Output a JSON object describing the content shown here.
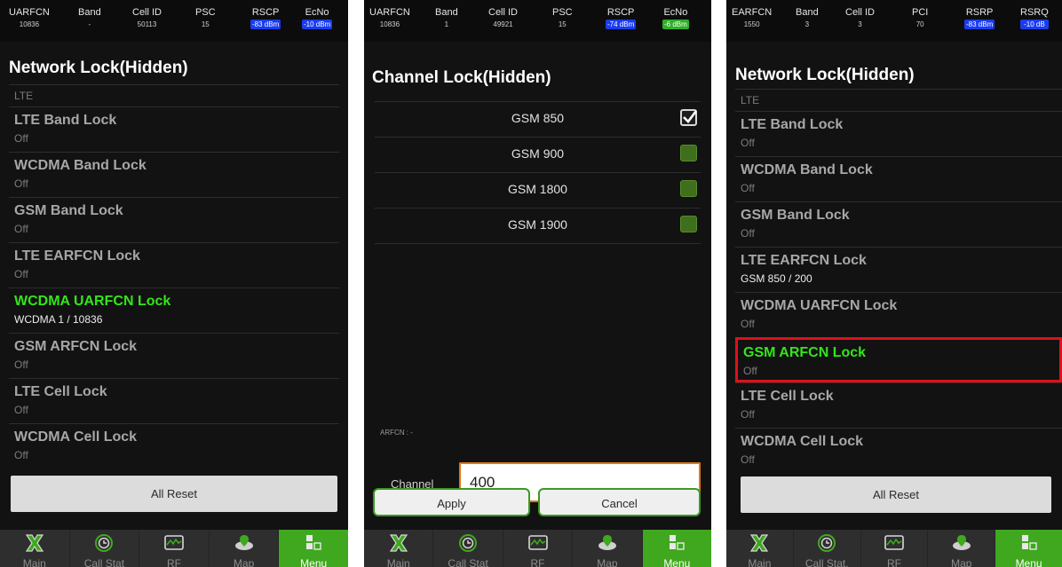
{
  "panel1": {
    "header": [
      {
        "label": "UARFCN",
        "value": "10836"
      },
      {
        "label": "Band",
        "value": "-"
      },
      {
        "label": "Cell ID",
        "value": "50113"
      },
      {
        "label": "PSC",
        "value": "15"
      },
      {
        "label": "RSCP",
        "value": "-83 dBm",
        "badge": "blue"
      },
      {
        "label": "EcNo",
        "value": "-10 dBm",
        "badge": "blue"
      }
    ],
    "title": "Network Lock(Hidden)",
    "section": "LTE",
    "items": [
      {
        "title": "LTE Band Lock",
        "sub": "Off"
      },
      {
        "title": "WCDMA Band Lock",
        "sub": "Off"
      },
      {
        "title": "GSM Band Lock",
        "sub": "Off"
      },
      {
        "title": "LTE EARFCN Lock",
        "sub": "Off"
      },
      {
        "title": "WCDMA UARFCN Lock",
        "sub": "WCDMA 1 / 10836",
        "active": true
      },
      {
        "title": "GSM ARFCN Lock",
        "sub": "Off"
      },
      {
        "title": "LTE Cell Lock",
        "sub": "Off"
      },
      {
        "title": "WCDMA Cell Lock",
        "sub": "Off"
      }
    ],
    "reset_label": "All Reset"
  },
  "panel2": {
    "header": [
      {
        "label": "UARFCN",
        "value": "10836"
      },
      {
        "label": "Band",
        "value": "1"
      },
      {
        "label": "Cell ID",
        "value": "49921"
      },
      {
        "label": "PSC",
        "value": "15"
      },
      {
        "label": "RSCP",
        "value": "-74 dBm",
        "badge": "blue"
      },
      {
        "label": "EcNo",
        "value": "-6 dBm",
        "badge": "green"
      }
    ],
    "title": "Channel Lock(Hidden)",
    "channels": [
      {
        "label": "GSM 850",
        "checked": true
      },
      {
        "label": "GSM 900",
        "checked": false
      },
      {
        "label": "GSM 1800",
        "checked": false
      },
      {
        "label": "GSM 1900",
        "checked": false
      }
    ],
    "arfcn_label": "ARFCN : -",
    "channel_label": "Channel",
    "channel_value": "400",
    "apply_label": "Apply",
    "cancel_label": "Cancel"
  },
  "panel3": {
    "header": [
      {
        "label": "EARFCN",
        "value": "1550"
      },
      {
        "label": "Band",
        "value": "3"
      },
      {
        "label": "Cell ID",
        "value": "3"
      },
      {
        "label": "PCI",
        "value": "70"
      },
      {
        "label": "RSRP",
        "value": "-83 dBm",
        "badge": "blue"
      },
      {
        "label": "RSRQ",
        "value": "-10 dB",
        "badge": "blue"
      }
    ],
    "title": "Network Lock(Hidden)",
    "section": "LTE",
    "items": [
      {
        "title": "LTE Band Lock",
        "sub": "Off"
      },
      {
        "title": "WCDMA Band Lock",
        "sub": "Off"
      },
      {
        "title": "GSM Band Lock",
        "sub": "Off"
      },
      {
        "title": "LTE EARFCN Lock",
        "sub": "GSM 850 / 200"
      },
      {
        "title": "WCDMA UARFCN Lock",
        "sub": "Off"
      },
      {
        "title": "GSM ARFCN Lock",
        "sub": "Off",
        "active": true,
        "highlighted": true
      },
      {
        "title": "LTE Cell Lock",
        "sub": "Off"
      },
      {
        "title": "WCDMA Cell Lock",
        "sub": "Off"
      }
    ],
    "reset_label": "All Reset"
  },
  "nav": [
    {
      "label": "Main",
      "icon": "x-mark-icon"
    },
    {
      "label": "Call Stat",
      "icon": "call-stat-icon"
    },
    {
      "label": "RF",
      "icon": "rf-monitor-icon"
    },
    {
      "label": "Map",
      "icon": "map-icon"
    },
    {
      "label": "Menu",
      "icon": "menu-grid-icon",
      "selected": true
    }
  ],
  "nav_p3_call_label": "Call Stat.",
  "colors": {
    "accent_green": "#33e619",
    "highlight_red": "#e0101a",
    "badge_blue": "#1a3cf0",
    "badge_green": "#2fae2a",
    "input_border": "#e07a14"
  }
}
